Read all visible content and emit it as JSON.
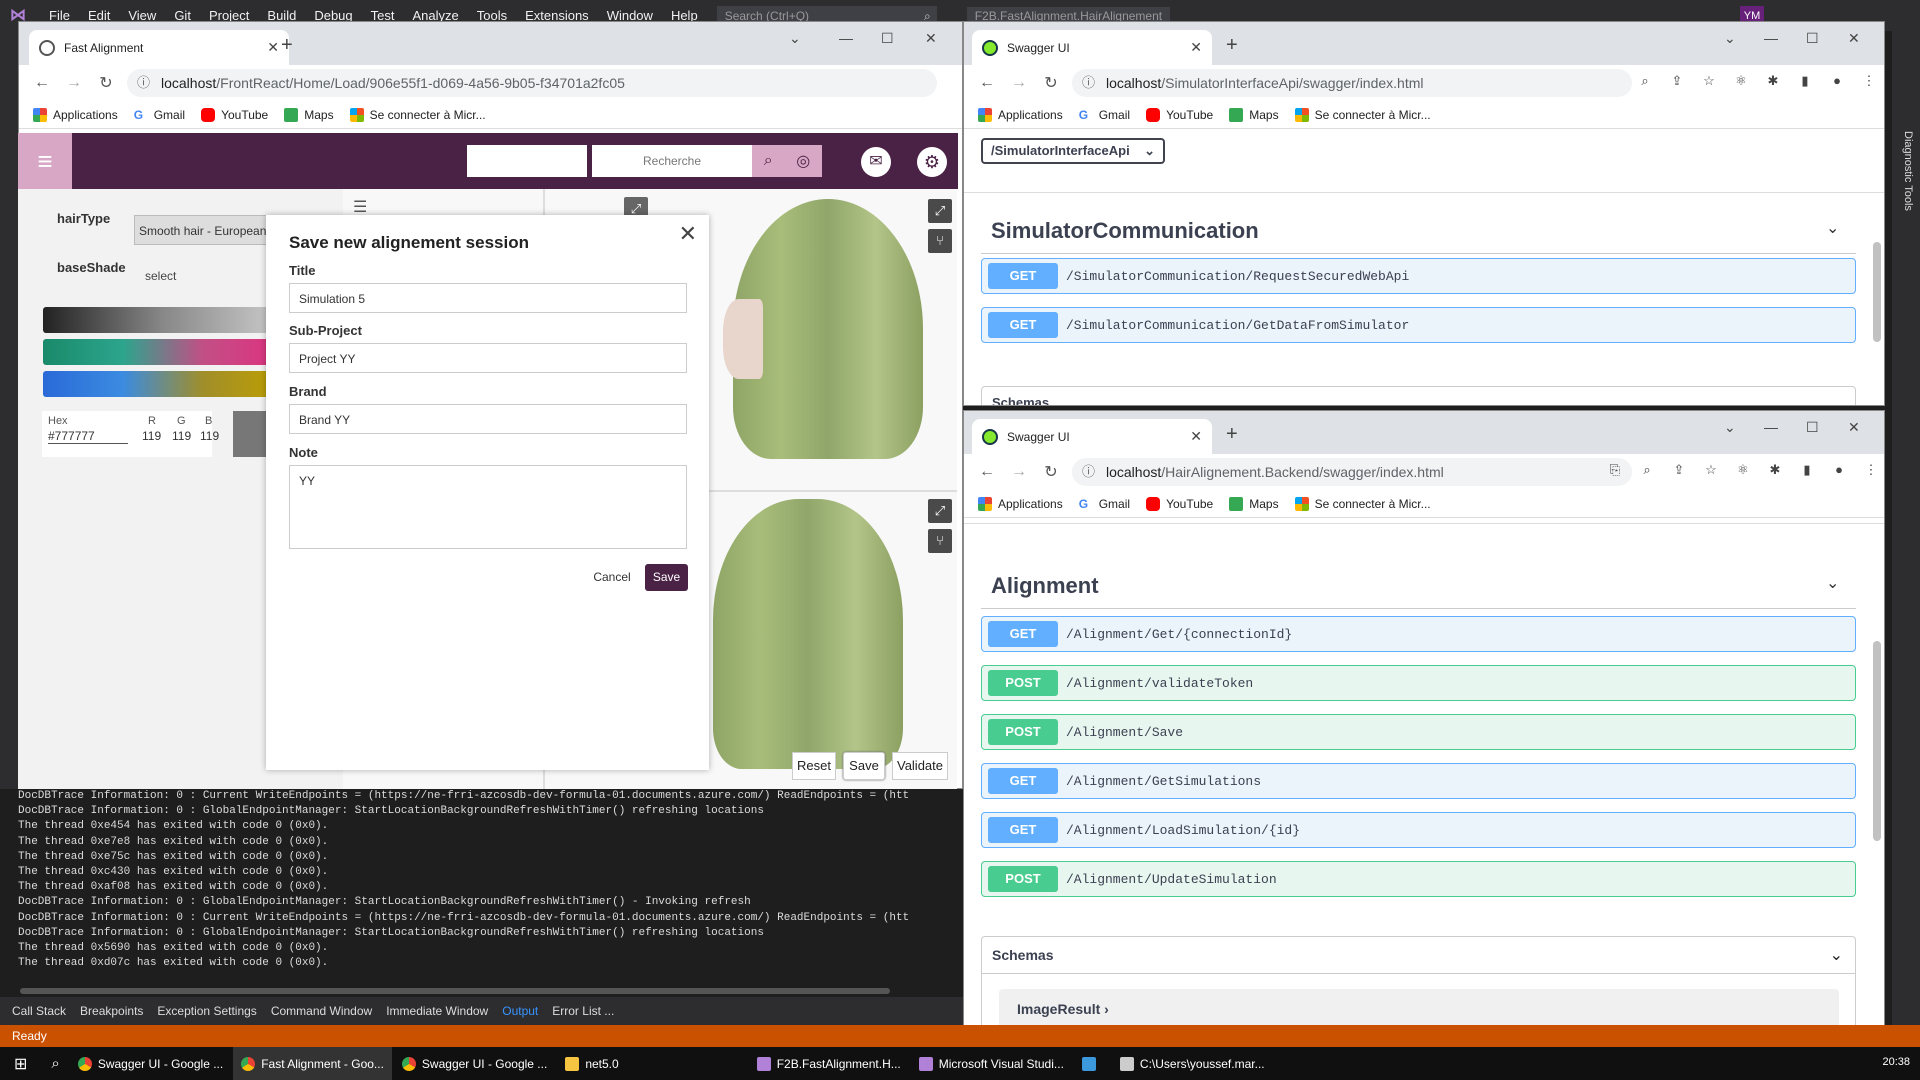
{
  "vs": {
    "menus": [
      "File",
      "Edit",
      "View",
      "Git",
      "Project",
      "Build",
      "Debug",
      "Test",
      "Analyze",
      "Tools",
      "Extensions",
      "Window",
      "Help"
    ],
    "search_placeholder": "Search (Ctrl+Q)",
    "solution": "F2B.FastAlignment.HairAlignement",
    "user": "YM",
    "diag": "Diagnostic Tools",
    "output_lines": [
      {
        "text": "DocDBTrace Information: 0 : Current WriteEndpoints = (https://ne-frri-azcosdb-dev-formula-01.documents.azure.com/) ReadEndpoints = (htt"
      },
      {
        "text": "DocDBTrace Information: 0 : GlobalEndpointManager: StartLocationBackgroundRefreshWithTimer() refreshing locations"
      },
      {
        "text": "The thread 0xe454 has exited with code 0 (0x0)."
      },
      {
        "text": "The thread 0xe7e8 has exited with code 0 (0x0)."
      },
      {
        "text": "The thread 0xe75c has exited with code 0 (0x0)."
      },
      {
        "text": "The thread 0xc430 has exited with code 0 (0x0)."
      },
      {
        "text": "The thread 0xaf08 has exited with code 0 (0x0)."
      },
      {
        "text": "DocDBTrace Information: 0 : GlobalEndpointManager: StartLocationBackgroundRefreshWithTimer() - Invoking refresh"
      },
      {
        "text": "DocDBTrace Information: 0 : Current WriteEndpoints = (https://ne-frri-azcosdb-dev-formula-01.documents.azure.com/) ReadEndpoints = (htt"
      },
      {
        "text": "DocDBTrace Information: 0 : GlobalEndpointManager: StartLocationBackgroundRefreshWithTimer() refreshing locations"
      },
      {
        "text": "The thread 0x5690 has exited with code 0 (0x0)."
      },
      {
        "text": "The thread 0xd07c has exited with code 0 (0x0)."
      }
    ],
    "bottom_tabs": [
      "Call Stack",
      "Breakpoints",
      "Exception Settings",
      "Command Window",
      "Immediate Window",
      "Output",
      "Error List ..."
    ],
    "active_tab": "Output",
    "status": "Ready"
  },
  "bookmarks": [
    "Applications",
    "Gmail",
    "YouTube",
    "Maps",
    "Se connecter à Micr..."
  ],
  "win1": {
    "tab_title": "Fast Alignment",
    "url_host": "localhost",
    "url_path": "/FrontReact/Home/Load/906e55f1-d069-4a56-9b05-f34701a2fc05",
    "search_placeholder": "Recherche",
    "hair_type_label": "hairType",
    "hair_type_value": "Smooth hair - European",
    "base_shade_label": "baseShade",
    "base_shade_value": "select",
    "hex_label": "Hex",
    "hex_value": "#777777",
    "r_label": "R",
    "r": "119",
    "g_label": "G",
    "g": "119",
    "b_label": "B",
    "b": "119",
    "viewer_buttons": [
      "Reset",
      "Save",
      "Validate"
    ],
    "modal": {
      "title": "Save new alignement session",
      "title_label": "Title",
      "title_value": "Simulation 5",
      "subproject_label": "Sub-Project",
      "subproject_value": "Project YY",
      "brand_label": "Brand",
      "brand_value": "Brand YY",
      "note_label": "Note",
      "note_value": "YY",
      "cancel": "Cancel",
      "save": "Save"
    }
  },
  "win2": {
    "tab_title": "Swagger UI",
    "url_host": "localhost",
    "url_path": "/SimulatorInterfaceApi/swagger/index.html",
    "server_select": "/SimulatorInterfaceApi",
    "section": "SimulatorCommunication",
    "ops": [
      {
        "method": "GET",
        "path": "/SimulatorCommunication/RequestSecuredWebApi"
      },
      {
        "method": "GET",
        "path": "/SimulatorCommunication/GetDataFromSimulator"
      }
    ],
    "schemas": "Schemas"
  },
  "win3": {
    "tab_title": "Swagger UI",
    "url_host": "localhost",
    "url_path": "/HairAlignement.Backend/swagger/index.html",
    "section": "Alignment",
    "ops": [
      {
        "method": "GET",
        "path": "/Alignment/Get/{connectionId}"
      },
      {
        "method": "POST",
        "path": "/Alignment/validateToken"
      },
      {
        "method": "POST",
        "path": "/Alignment/Save"
      },
      {
        "method": "GET",
        "path": "/Alignment/GetSimulations"
      },
      {
        "method": "GET",
        "path": "/Alignment/LoadSimulation/{id}"
      },
      {
        "method": "POST",
        "path": "/Alignment/UpdateSimulation"
      }
    ],
    "schemas": "Schemas",
    "schema_item": "ImageResult"
  },
  "taskbar": {
    "items": [
      "Swagger UI - Google ...",
      "Fast Alignment - Goo...",
      "Swagger UI - Google ...",
      "net5.0",
      "F2B.FastAlignment.H...",
      "Microsoft Visual Studi...",
      "C:\\Users\\youssef.mar..."
    ],
    "time": "20:38"
  },
  "colors": {
    "app_bar": "#4a2245",
    "accent": "#d8a7c5",
    "get": "#61affe",
    "post": "#49cc90",
    "vs_status": "#ca5100"
  }
}
